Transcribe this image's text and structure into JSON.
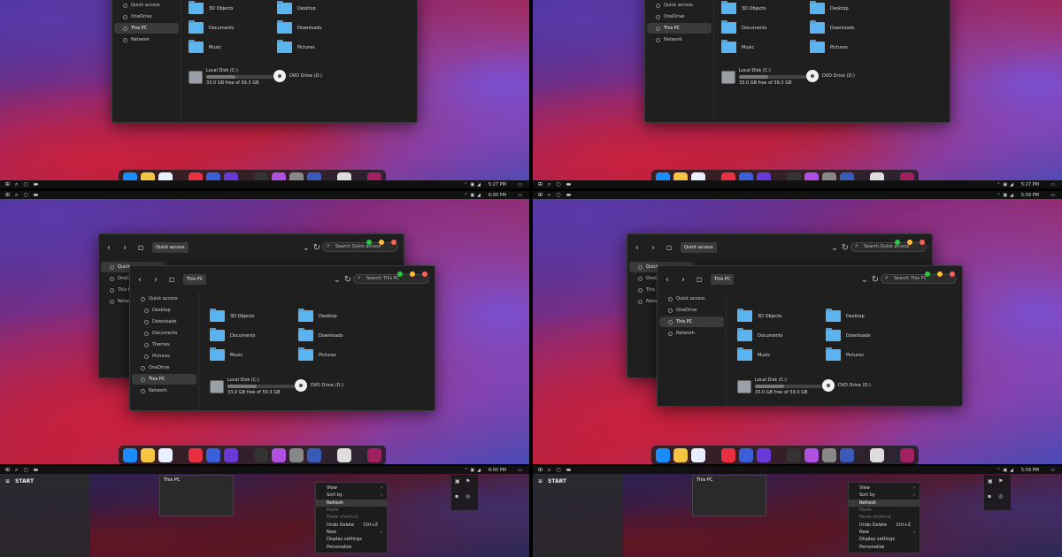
{
  "explorer": {
    "sidebar": [
      "Quick access",
      "OneDrive",
      "This PC",
      "Network"
    ],
    "sidebar_expanded": [
      "Quick access",
      "Desktop",
      "Downloads",
      "Documents",
      "Themes",
      "Pictures",
      "OneDrive",
      "This PC",
      "Network"
    ],
    "folders": [
      "3D Objects",
      "Desktop",
      "Documents",
      "Downloads",
      "Music",
      "Pictures"
    ],
    "drive_c": {
      "name": "Local Disk (C:)",
      "free": "33.0 GB free of 59.3 GB",
      "used_fraction": 0.44
    },
    "drive_d": {
      "name": "DVD Drive (D:)"
    },
    "back_crumb": "Quick access",
    "back_search": "Search Quick access",
    "front_crumb": "This PC",
    "front_search": "Search This PC"
  },
  "taskbar": {
    "times": [
      "5:27 PM",
      "5:27 PM",
      "6:00 PM",
      "5:59 PM"
    ]
  },
  "start": {
    "label": "START"
  },
  "thumbnail": {
    "title": "This PC"
  },
  "context_menu": [
    {
      "label": "View",
      "arrow": "›"
    },
    {
      "label": "Sort by",
      "arrow": "›"
    },
    {
      "label": "Refresh",
      "hl": true
    },
    {
      "label": "Paste",
      "dis": true
    },
    {
      "label": "Paste shortcut",
      "dis": true
    },
    {
      "label": "Undo Delete",
      "shortcut": "Ctrl+Z"
    },
    {
      "label": "New",
      "arrow": "›"
    },
    {
      "label": "Display settings"
    },
    {
      "label": "Personalize"
    }
  ],
  "colors": {
    "folder": "#5bb4f0",
    "close": "#ff5f57",
    "min": "#febc2e",
    "max": "#28c840",
    "dock_bg": "#1e1e1e"
  },
  "dock_icons": [
    "finder-icon",
    "photos-icon",
    "safari-icon",
    "news-icon",
    "siri-icon",
    "imovie-icon",
    "stocks-icon",
    "podcasts-icon",
    "settings-icon",
    "screens-icon",
    "trash-icon",
    "preview-icon"
  ]
}
